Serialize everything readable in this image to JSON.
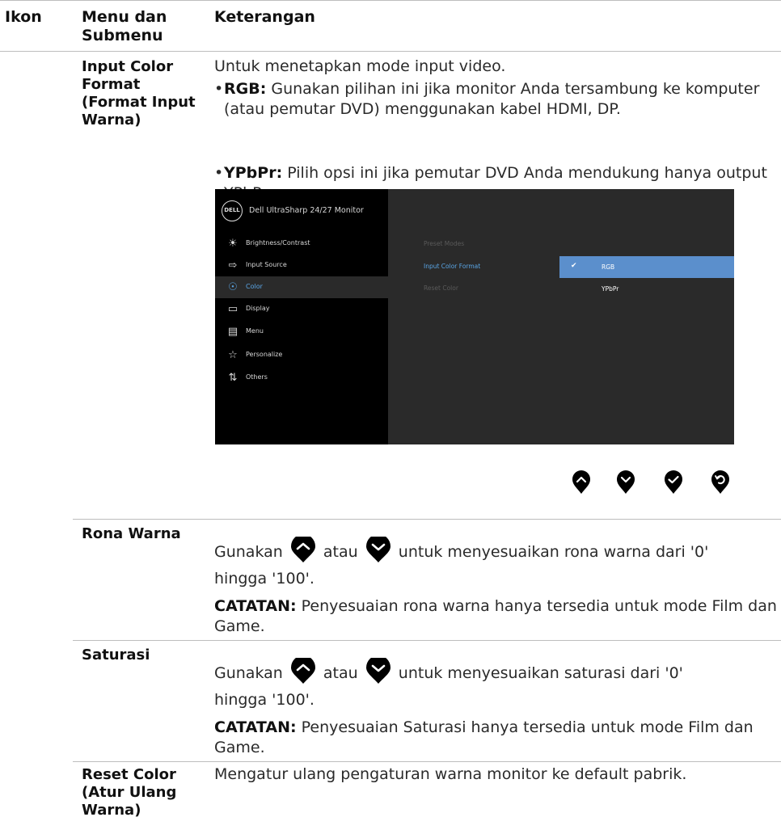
{
  "table": {
    "headers": {
      "icon": "Ikon",
      "menu": "Menu dan Submenu",
      "description": "Keterangan"
    },
    "rows": [
      {
        "submenu": "Input Color Format (Format Input Warna)",
        "intro": "Untuk menetapkan mode input video.",
        "bullets": [
          {
            "term": "RGB:",
            "text": " Gunakan pilihan ini jika monitor Anda tersambung ke komputer (atau pemutar DVD) menggunakan kabel HDMI, DP."
          },
          {
            "term": "YPbPr:",
            "text": " Pilih opsi ini jika pemutar DVD Anda mendukung hanya output YPbPr."
          }
        ]
      },
      {
        "submenu": "Rona Warna",
        "line_start": "Gunakan",
        "line_mid": "atau",
        "line_end": "untuk menyesuaikan rona warna dari '0'",
        "line_cont": "hingga '100'.",
        "note_term": "CATATAN:",
        "note_text": " Penyesuaian rona warna hanya tersedia untuk mode Film dan Game."
      },
      {
        "submenu": "Saturasi",
        "line_start": "Gunakan",
        "line_mid": "atau",
        "line_end": "untuk menyesuaikan saturasi dari '0'",
        "line_cont": "hingga '100'.",
        "note_term": "CATATAN:",
        "note_text": " Penyesuaian Saturasi hanya tersedia untuk mode Film dan Game."
      },
      {
        "submenu": "Reset Color (Atur Ulang Warna)",
        "text": "Mengatur ulang pengaturan warna monitor ke default pabrik."
      }
    ]
  },
  "osd": {
    "logo": "DELL",
    "title": "Dell UltraSharp 24/27 Monitor",
    "menu": [
      {
        "label": "Brightness/Contrast",
        "icon": "brightness-icon"
      },
      {
        "label": "Input Source",
        "icon": "input-source-icon"
      },
      {
        "label": "Color",
        "icon": "color-palette-icon",
        "active": true
      },
      {
        "label": "Display",
        "icon": "display-icon"
      },
      {
        "label": "Menu",
        "icon": "menu-icon"
      },
      {
        "label": "Personalize",
        "icon": "star-icon"
      },
      {
        "label": "Others",
        "icon": "others-icon"
      }
    ],
    "options": [
      "Preset Modes",
      "Input Color Format",
      "Reset Color"
    ],
    "choices": [
      {
        "label": "RGB",
        "selected": true
      },
      {
        "label": "YPbPr",
        "selected": false
      }
    ]
  },
  "buttons": [
    "up-arrow-icon",
    "down-arrow-icon",
    "check-icon",
    "back-icon"
  ],
  "colors": {
    "osd_bg": "#2a2a2a",
    "osd_left": "#000000",
    "highlight": "#5b8fcc",
    "accent_text": "#5aa6e6"
  }
}
